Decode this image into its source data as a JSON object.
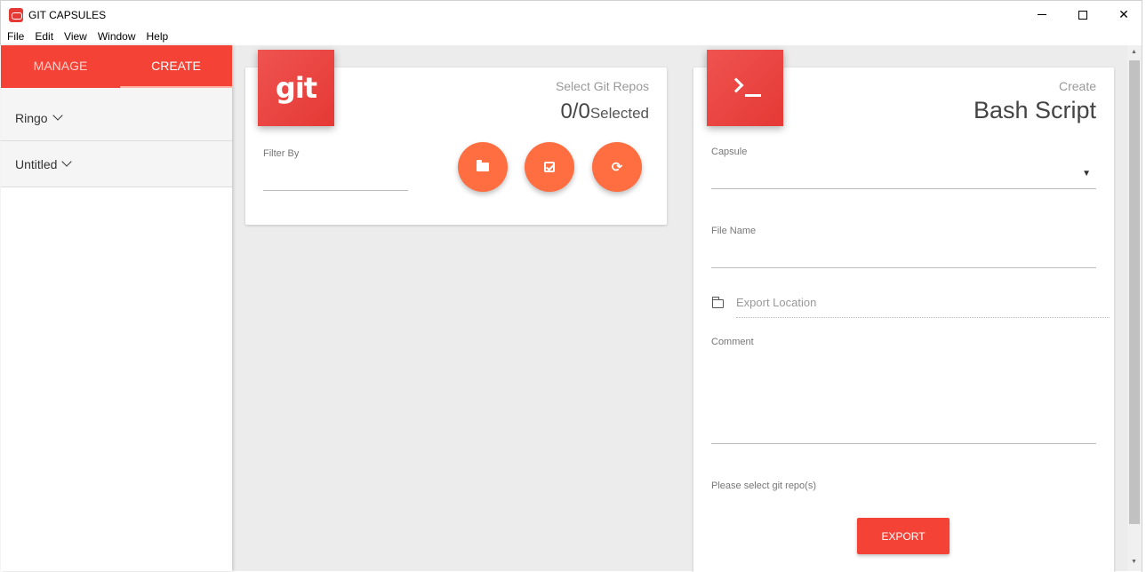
{
  "window": {
    "title": "GIT CAPSULES",
    "controls": {
      "minimize": "",
      "maximize": "",
      "close": "✕"
    }
  },
  "menu": [
    "File",
    "Edit",
    "View",
    "Window",
    "Help"
  ],
  "sidebar": {
    "tabs": [
      {
        "label": "MANAGE",
        "active": false
      },
      {
        "label": "CREATE",
        "active": true
      }
    ],
    "items": [
      {
        "label": "Ringo"
      },
      {
        "label": "Untitled"
      }
    ]
  },
  "git_card": {
    "badge_text": "git",
    "caption": "Select Git Repos",
    "count": "0/0",
    "count_suffix": "Selected",
    "filter_label": "Filter By",
    "filter_value": "",
    "refresh_glyph": "⟳"
  },
  "bash_card": {
    "caption": "Create",
    "title": "Bash Script",
    "capsule_label": "Capsule",
    "capsule_value": "",
    "select_arrow": "▼",
    "file_name_label": "File Name",
    "file_name_value": "",
    "export_location_placeholder": "Export Location",
    "comment_label": "Comment",
    "comment_value": "",
    "hint": "Please select git repo(s)",
    "export_label": "EXPORT"
  },
  "scrollbar": {
    "up": "▲",
    "down": "▼"
  },
  "colors": {
    "accent": "#f44336",
    "fab": "#ff6e40",
    "background": "#ececec"
  }
}
